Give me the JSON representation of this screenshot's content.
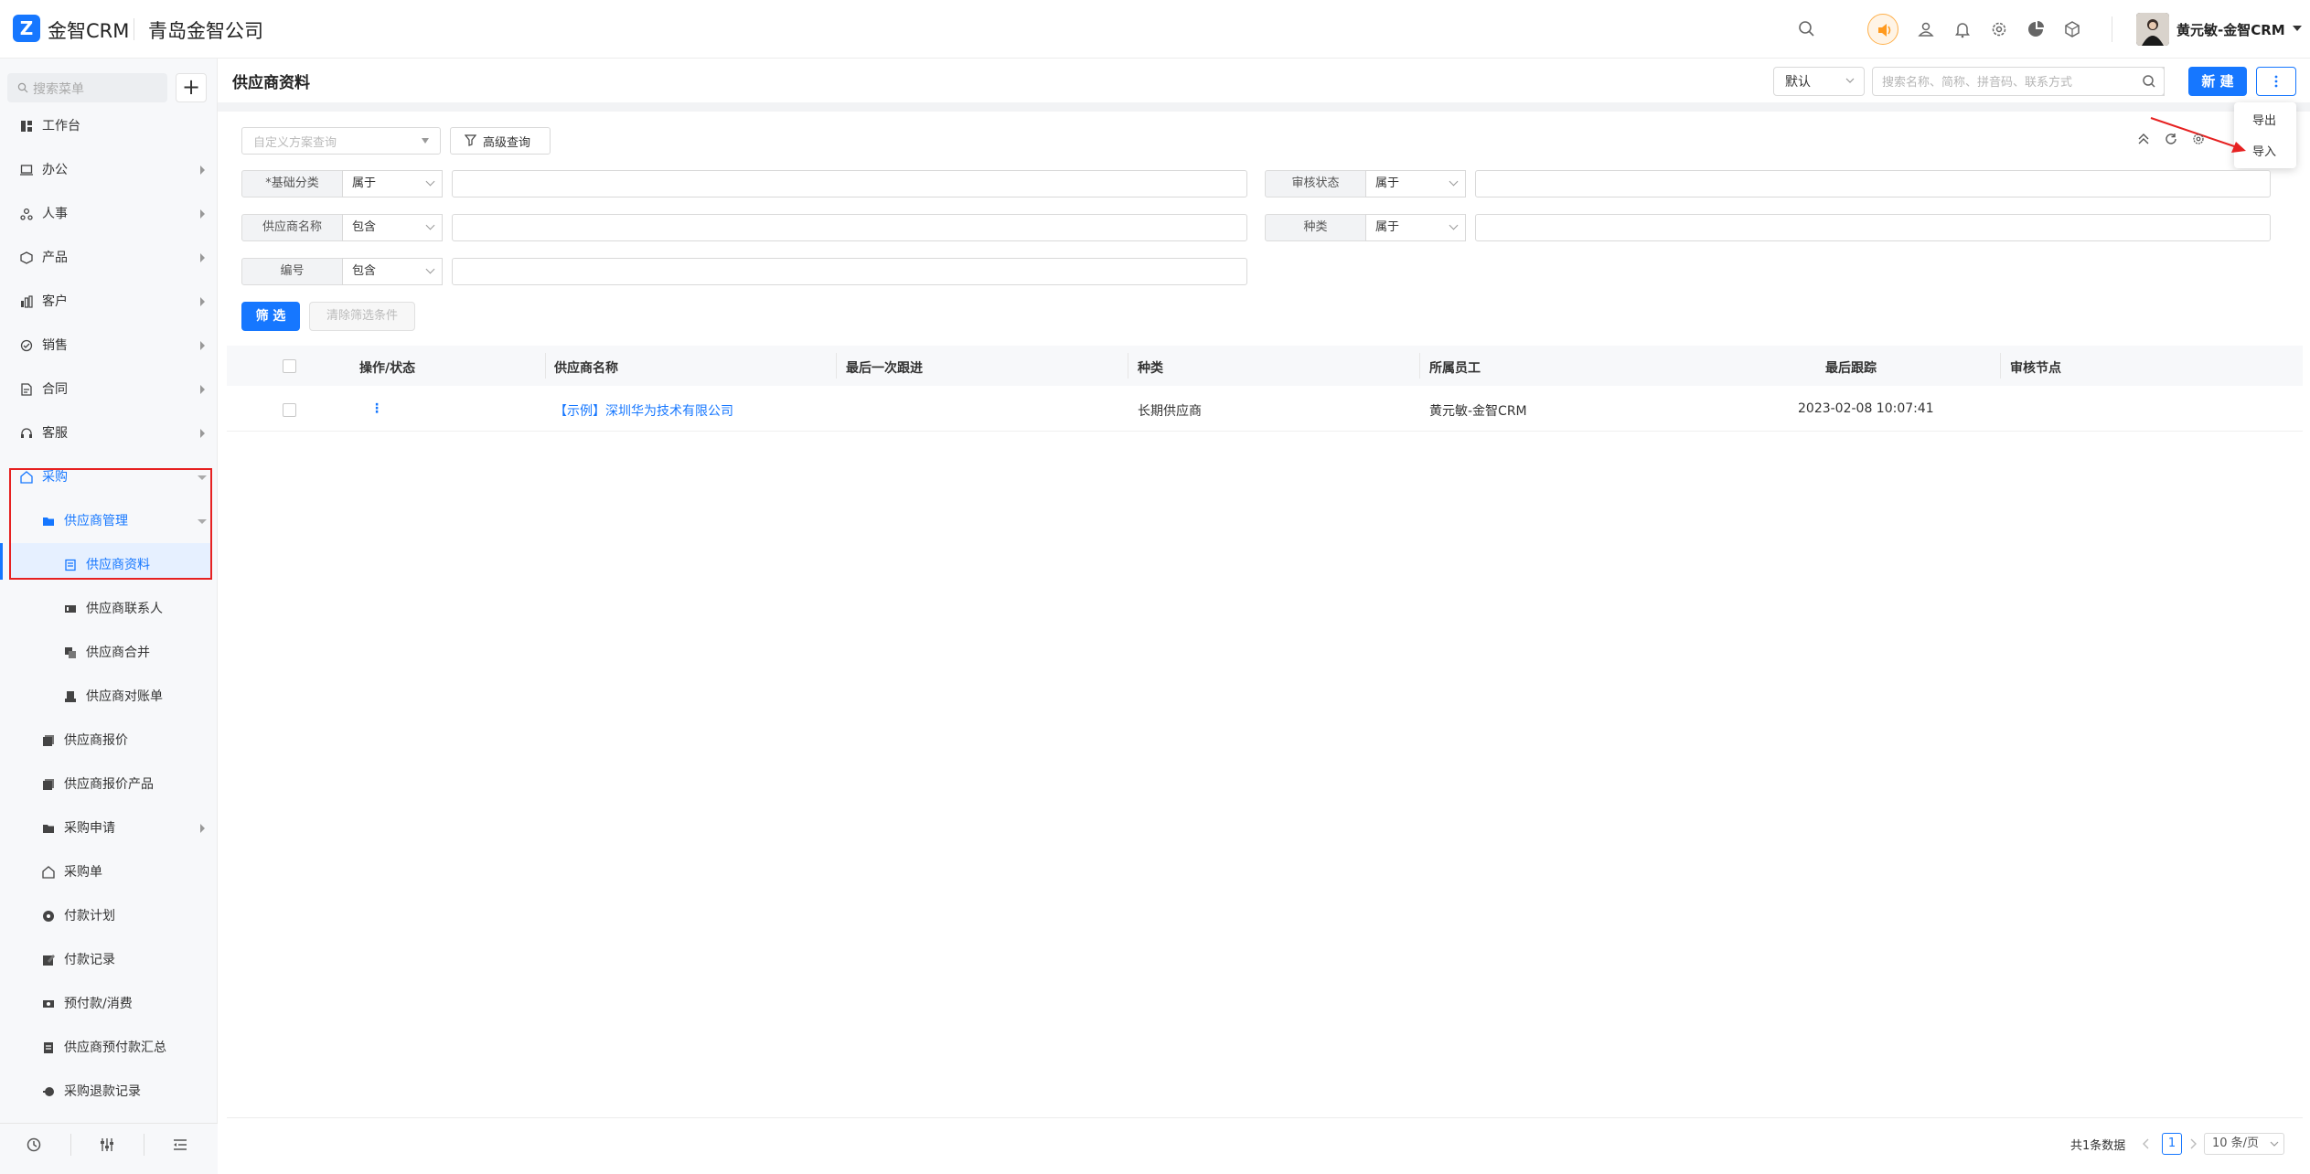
{
  "app": {
    "brand": "金智CRM",
    "company": "青岛金智公司",
    "user": "黄元敏-金智CRM"
  },
  "colors": {
    "primary": "#1677ff",
    "highlight_box": "#e62121",
    "speaker_badge": "#ffb04a"
  },
  "topbar_icons": [
    "search-icon",
    "speaker-icon",
    "contacts-icon",
    "bell-icon",
    "gear-icon",
    "pie-chart-icon",
    "cube-icon"
  ],
  "sidebar": {
    "search_placeholder": "搜索菜单",
    "add_label": "+",
    "items": [
      {
        "label": "工作台",
        "icon": "dashboard-icon"
      },
      {
        "label": "办公",
        "icon": "office-icon"
      },
      {
        "label": "人事",
        "icon": "hr-icon"
      },
      {
        "label": "产品",
        "icon": "product-icon"
      },
      {
        "label": "客户",
        "icon": "customer-icon"
      },
      {
        "label": "销售",
        "icon": "sales-icon"
      },
      {
        "label": "合同",
        "icon": "contract-icon"
      },
      {
        "label": "客服",
        "icon": "service-icon"
      },
      {
        "label": "采购",
        "icon": "purchase-icon"
      },
      {
        "label": "供应商管理",
        "icon": "folder-icon"
      },
      {
        "label": "供应商资料",
        "icon": "document-icon"
      },
      {
        "label": "供应商联系人",
        "icon": "id-card-icon"
      },
      {
        "label": "供应商合并",
        "icon": "merge-icon"
      },
      {
        "label": "供应商对账单",
        "icon": "statement-icon"
      },
      {
        "label": "供应商报价",
        "icon": "quote-icon"
      },
      {
        "label": "供应商报价产品",
        "icon": "quote-product-icon"
      },
      {
        "label": "采购申请",
        "icon": "folder-icon"
      },
      {
        "label": "采购单",
        "icon": "purchase-order-icon"
      },
      {
        "label": "付款计划",
        "icon": "plan-icon"
      },
      {
        "label": "付款记录",
        "icon": "record-icon"
      },
      {
        "label": "预付款/消费",
        "icon": "prepay-icon"
      },
      {
        "label": "供应商预付款汇总",
        "icon": "summary-icon"
      },
      {
        "label": "采购退款记录",
        "icon": "refund-icon"
      }
    ]
  },
  "header": {
    "title": "供应商资料",
    "view": "默认",
    "search_placeholder": "搜索名称、简称、拼音码、联系方式",
    "new_label": "新 建",
    "more_label": "⋮",
    "dropdown": [
      "导出",
      "导入"
    ]
  },
  "filters": {
    "scheme_placeholder": "自定义方案查询",
    "advanced_label": "高级查询",
    "rows": [
      {
        "label": "*基础分类",
        "op": "属于"
      },
      {
        "label": "审核状态",
        "op": "属于"
      },
      {
        "label": "供应商名称",
        "op": "包含"
      },
      {
        "label": "种类",
        "op": "属于"
      },
      {
        "label": "编号",
        "op": "包含"
      }
    ],
    "filter_label": "筛 选",
    "clear_label": "清除筛选条件"
  },
  "table": {
    "columns": [
      "操作/状态",
      "供应商名称",
      "最后一次跟进",
      "种类",
      "所属员工",
      "最后跟踪",
      "审核节点"
    ],
    "rows": [
      {
        "actions": "⋮",
        "name": "【示例】深圳华为技术有限公司",
        "last_followup": "",
        "kind": "长期供应商",
        "employee": "黄元敏-金智CRM",
        "last_track": "2023-02-08 10:07:41",
        "node": ""
      }
    ]
  },
  "pagination": {
    "total": "共1条数据",
    "page": "1",
    "page_size": "10 条/页"
  }
}
